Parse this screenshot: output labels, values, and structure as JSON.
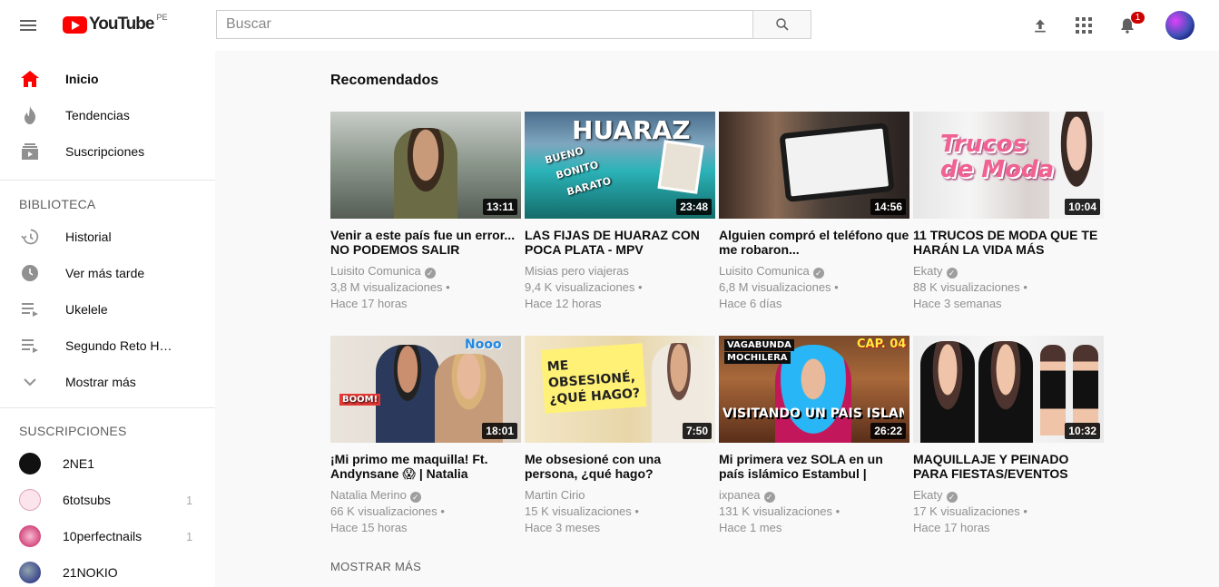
{
  "header": {
    "logo_text": "YouTube",
    "country": "PE",
    "search_placeholder": "Buscar",
    "notifications_count": "1"
  },
  "sidebar": {
    "main_items": [
      {
        "label": "Inicio",
        "icon": "home-icon"
      },
      {
        "label": "Tendencias",
        "icon": "fire-icon"
      },
      {
        "label": "Suscripciones",
        "icon": "subscriptions-icon"
      }
    ],
    "library_title": "BIBLIOTECA",
    "library_items": [
      {
        "label": "Historial",
        "icon": "history-icon"
      },
      {
        "label": "Ver más tarde",
        "icon": "clock-icon"
      },
      {
        "label": "Ukelele",
        "icon": "playlist-icon"
      },
      {
        "label": "Segundo Reto Hii...",
        "icon": "playlist-icon"
      },
      {
        "label": "Mostrar más",
        "icon": "chevron-down-icon"
      }
    ],
    "subscriptions_title": "SUSCRIPCIONES",
    "subscriptions": [
      {
        "label": "2NE1",
        "count": ""
      },
      {
        "label": "6totsubs",
        "count": "1"
      },
      {
        "label": "10perfectnails",
        "count": "1"
      },
      {
        "label": "21NOKIO",
        "count": ""
      }
    ]
  },
  "main": {
    "title": "Recomendados",
    "show_more": "MOSTRAR MÁS",
    "videos": [
      {
        "title": "Venir a este país fue un error... NO PODEMOS SALIR",
        "channel": "Luisito Comunica",
        "verified": true,
        "views": "3,8 M visualizaciones",
        "age": "Hace 17 horas",
        "duration": "13:11"
      },
      {
        "title": "LAS FIJAS DE HUARAZ CON POCA PLATA - MPV",
        "channel": "Misias pero viajeras",
        "verified": false,
        "views": "9,4 K visualizaciones",
        "age": "Hace 12 horas",
        "duration": "23:48",
        "thumb_text": "HUARAZ",
        "thumb_sub": [
          "BUENO",
          "BONITO",
          "BARATO"
        ]
      },
      {
        "title": "Alguien compró el teléfono que me robaron...",
        "channel": "Luisito Comunica",
        "verified": true,
        "views": "6,8 M visualizaciones",
        "age": "Hace 6 días",
        "duration": "14:56"
      },
      {
        "title": "11 TRUCOS DE MODA QUE TE HARÁN LA VIDA MÁS",
        "channel": "Ekaty",
        "verified": true,
        "views": "88 K visualizaciones",
        "age": "Hace 3 semanas",
        "duration": "10:04",
        "thumb_text": "Trucos de Moda"
      },
      {
        "title": "¡Mi primo me maquilla! Ft. Andynsane 😱 | Natalia",
        "channel": "Natalia Merino",
        "verified": true,
        "views": "66 K visualizaciones",
        "age": "Hace 15 horas",
        "duration": "18:01",
        "thumb_text": "Nooo",
        "thumb_sub": [
          "BOOM!"
        ]
      },
      {
        "title": "Me obsesioné con una persona, ¿qué hago?",
        "channel": "Martin Cirio",
        "verified": false,
        "views": "15 K visualizaciones",
        "age": "Hace 3 meses",
        "duration": "7:50",
        "thumb_text": "ME OBSESIONÉ, ¿QUÉ HAGO?"
      },
      {
        "title": "Mi primera vez SOLA en un país islámico Estambul |",
        "channel": "ixpanea",
        "verified": true,
        "views": "131 K visualizaciones",
        "age": "Hace 1 mes",
        "duration": "26:22",
        "thumb_text": "VISITANDO UN PAIS ISLAMICO",
        "thumb_sub": [
          "VAGABUNDA",
          "MOCHILERA",
          "CAP. 04"
        ]
      },
      {
        "title": "MAQUILLAJE Y PEINADO PARA FIESTAS/EVENTOS",
        "channel": "Ekaty",
        "verified": true,
        "views": "17 K visualizaciones",
        "age": "Hace 17 horas",
        "duration": "10:32"
      }
    ]
  },
  "colors": {
    "accent": "#ff0000",
    "badge": "#cc0000",
    "text": "#0d0d0d",
    "meta": "#909090"
  }
}
